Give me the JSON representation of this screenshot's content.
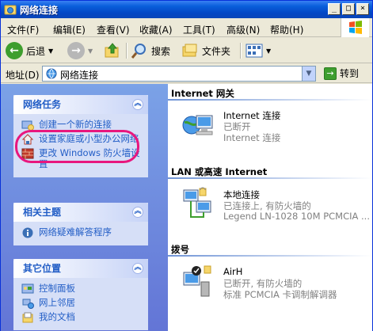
{
  "window": {
    "title": "网络连接"
  },
  "menu": [
    "文件(F)",
    "编辑(E)",
    "查看(V)",
    "收藏(A)",
    "工具(T)",
    "高级(N)",
    "帮助(H)"
  ],
  "toolbar": {
    "back": "后退",
    "search": "搜索",
    "folders": "文件夹"
  },
  "address": {
    "label": "地址(D)",
    "value": "网络连接",
    "go": "转到"
  },
  "tasks": {
    "network": {
      "title": "网络任务",
      "items": [
        "创建一个新的连接",
        "设置家庭或小型办公网络",
        "更改 Windows 防火墙设置"
      ]
    },
    "related": {
      "title": "相关主题",
      "items": [
        "网络疑难解答程序"
      ]
    },
    "other": {
      "title": "其它位置",
      "items": [
        "控制面板",
        "网上邻居",
        "我的文档"
      ]
    }
  },
  "sections": {
    "internet": {
      "title": "Internet 网关",
      "name": "Internet 连接",
      "status": "已断开",
      "device": "Internet 连接"
    },
    "lan": {
      "title": "LAN 或高速 Internet",
      "name": "本地连接",
      "status": "已连接上, 有防火墙的",
      "device": "Legend LN-1028 10M PCMCIA ..."
    },
    "dialup": {
      "title": "拨号",
      "name": "AirH",
      "status": "已断开, 有防火墙的",
      "device": "标准 PCMCIA 卡调制解调器"
    }
  },
  "colors": {
    "highlight": "#E8177E",
    "taskLink": "#215DC6",
    "titleBar": "#0A5FDB"
  }
}
